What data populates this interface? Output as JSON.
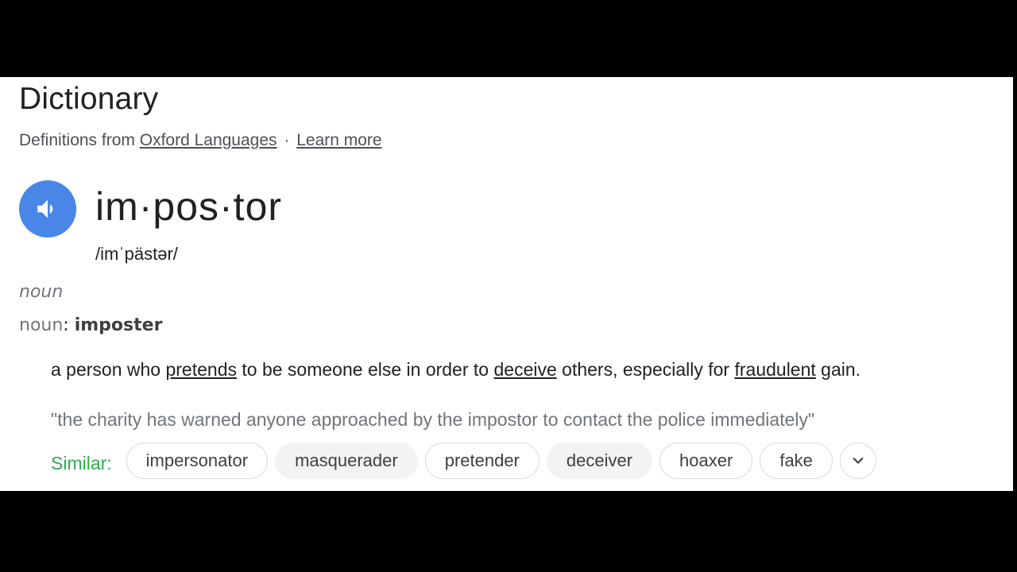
{
  "header": {
    "title": "Dictionary",
    "source_prefix": "Definitions from",
    "source_link": "Oxford Languages",
    "separator": "·",
    "learn_more": "Learn more"
  },
  "entry": {
    "speaker_icon": "volume-up-icon",
    "accent_color": "#4a86e8",
    "headword": "im·pos·tor",
    "phonetic": "/imˈpästər/",
    "part_of_speech": "noun",
    "variant_label": "noun",
    "variant_colon": ":",
    "variant_word": "imposter"
  },
  "definition": {
    "parts": [
      {
        "text": "a person who ",
        "link": false
      },
      {
        "text": "pretends",
        "link": true
      },
      {
        "text": " to be someone else in order to ",
        "link": false
      },
      {
        "text": "deceive",
        "link": true
      },
      {
        "text": " others, especially for ",
        "link": false
      },
      {
        "text": "fraudulent",
        "link": true
      },
      {
        "text": " gain.",
        "link": false
      }
    ],
    "example": "\"the charity has warned anyone approached by the impostor to contact the police immediately\""
  },
  "similar": {
    "label": "Similar:",
    "label_color": "#34a853",
    "chips": [
      {
        "label": "impersonator",
        "filled": false
      },
      {
        "label": "masquerader",
        "filled": true
      },
      {
        "label": "pretender",
        "filled": false
      },
      {
        "label": "deceiver",
        "filled": true
      },
      {
        "label": "hoaxer",
        "filled": false
      },
      {
        "label": "fake",
        "filled": false
      }
    ],
    "more_icon": "chevron-down-icon"
  }
}
